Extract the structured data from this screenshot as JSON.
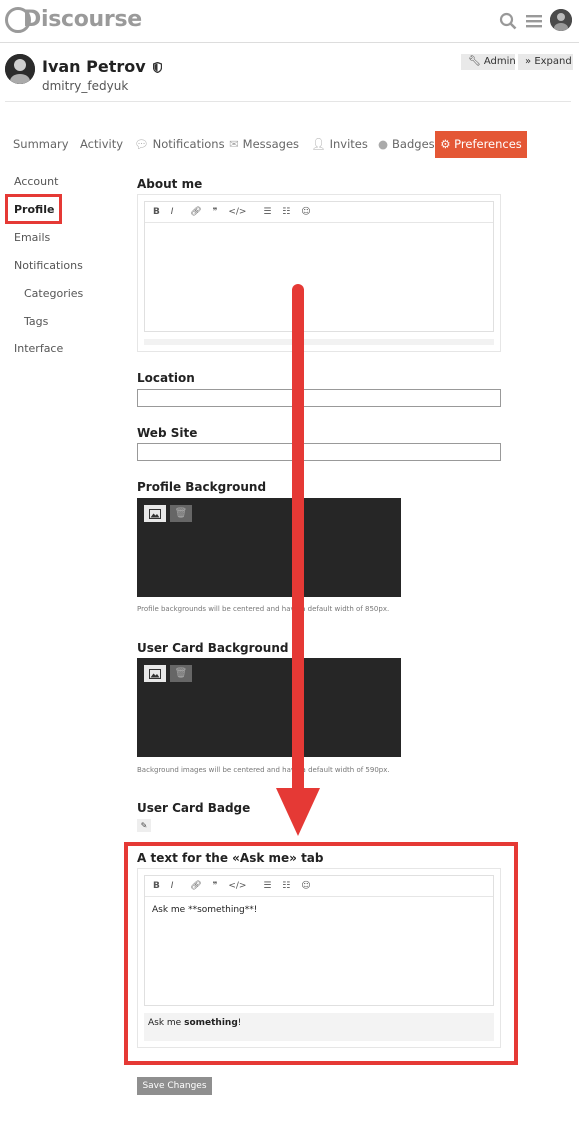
{
  "header": {
    "logo_text": "Discourse",
    "icons": [
      "search-icon",
      "hamburger-menu-icon",
      "user-avatar"
    ]
  },
  "user": {
    "name": "Ivan Petrov",
    "username": "dmitry_fedyuk",
    "admin_label": "Admin",
    "expand_label": "Expand"
  },
  "nav": {
    "summary": "Summary",
    "activity": "Activity",
    "notifications": "Notifications",
    "messages": "Messages",
    "invites": "Invites",
    "badges": "Badges",
    "preferences": "Preferences"
  },
  "sidebar": {
    "items": [
      {
        "label": "Account"
      },
      {
        "label": "Profile"
      },
      {
        "label": "Emails"
      },
      {
        "label": "Notifications"
      },
      {
        "label": "Categories"
      },
      {
        "label": "Tags"
      },
      {
        "label": "Interface"
      }
    ]
  },
  "form": {
    "about_me": "About me",
    "location": "Location",
    "website": "Web Site",
    "profile_background": "Profile Background",
    "profile_background_note": "Profile backgrounds will be centered and have a default width of 850px.",
    "user_card_background": "User Card Background",
    "user_card_background_note": "Background images will be centered and have a default width of 590px.",
    "user_card_badge": "User Card Badge",
    "ask_me_label": "A text for the «Ask me» tab",
    "ask_me_value": "Ask me **something**!",
    "preview_prefix": "Ask me ",
    "preview_bold": "something",
    "preview_suffix": "!",
    "save_label": "Save Changes"
  },
  "colors": {
    "accent": "#e45735",
    "annotation": "#e53935"
  }
}
